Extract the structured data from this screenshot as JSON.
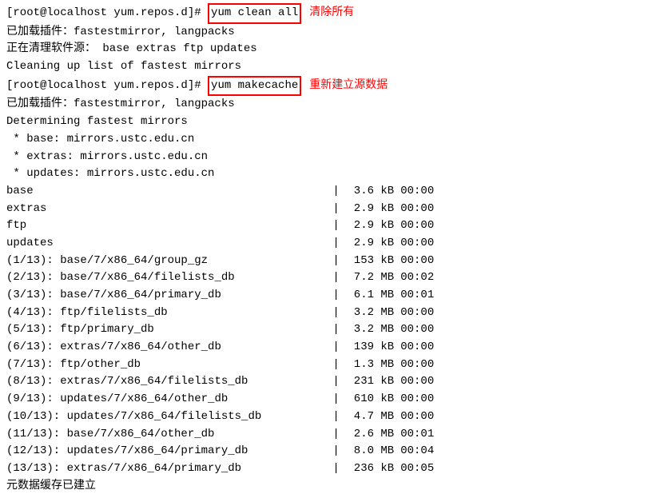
{
  "terminal": {
    "lines": [
      {
        "type": "prompt-highlight",
        "prefix": "[root@localhost yum.repos.d]# ",
        "highlight": "yum clean all",
        "annotation": "清除所有"
      },
      {
        "type": "plain",
        "text": "已加载插件：fastestmirror, langpacks"
      },
      {
        "type": "plain",
        "text": "正在清理软件源： base extras ftp updates"
      },
      {
        "type": "plain",
        "text": "Cleaning up list of fastest mirrors"
      },
      {
        "type": "prompt-highlight",
        "prefix": "[root@localhost yum.repos.d]# ",
        "highlight": "yum makecache",
        "annotation": "重新建立源数据"
      },
      {
        "type": "plain",
        "text": "已加载插件：fastestmirror, langpacks"
      },
      {
        "type": "plain",
        "text": "Determining fastest mirrors"
      },
      {
        "type": "plain",
        "text": " * base: mirrors.ustc.edu.cn"
      },
      {
        "type": "plain",
        "text": " * extras: mirrors.ustc.edu.cn"
      },
      {
        "type": "plain",
        "text": " * updates: mirrors.ustc.edu.cn"
      }
    ],
    "data_rows": [
      {
        "name": "base",
        "size": "3.6 kB",
        "time": "00:00"
      },
      {
        "name": "extras",
        "size": "2.9 kB",
        "time": "00:00"
      },
      {
        "name": "ftp",
        "size": "2.9 kB",
        "time": "00:00"
      },
      {
        "name": "updates",
        "size": "2.9 kB",
        "time": "00:00"
      },
      {
        "name": "(1/13): base/7/x86_64/group_gz",
        "size": "153 kB",
        "time": "00:00"
      },
      {
        "name": "(2/13): base/7/x86_64/filelists_db",
        "size": "7.2 MB",
        "time": "00:02"
      },
      {
        "name": "(3/13): base/7/x86_64/primary_db",
        "size": "6.1 MB",
        "time": "00:01"
      },
      {
        "name": "(4/13): ftp/filelists_db",
        "size": "3.2 MB",
        "time": "00:00"
      },
      {
        "name": "(5/13): ftp/primary_db",
        "size": "3.2 MB",
        "time": "00:00"
      },
      {
        "name": "(6/13): extras/7/x86_64/other_db",
        "size": "139 kB",
        "time": "00:00"
      },
      {
        "name": "(7/13): ftp/other_db",
        "size": "1.3 MB",
        "time": "00:00"
      },
      {
        "name": "(8/13): extras/7/x86_64/filelists_db",
        "size": "231 kB",
        "time": "00:00"
      },
      {
        "name": "(9/13): updates/7/x86_64/other_db",
        "size": "610 kB",
        "time": "00:00"
      },
      {
        "name": "(10/13): updates/7/x86_64/filelists_db",
        "size": "4.7 MB",
        "time": "00:00"
      },
      {
        "name": "(11/13): base/7/x86_64/other_db",
        "size": "2.6 MB",
        "time": "00:01"
      },
      {
        "name": "(12/13): updates/7/x86_64/primary_db",
        "size": "8.0 MB",
        "time": "00:04"
      },
      {
        "name": "(13/13): extras/7/x86_64/primary_db",
        "size": "236 kB",
        "time": "00:05"
      }
    ],
    "footer": "元数据缓存已建立"
  }
}
